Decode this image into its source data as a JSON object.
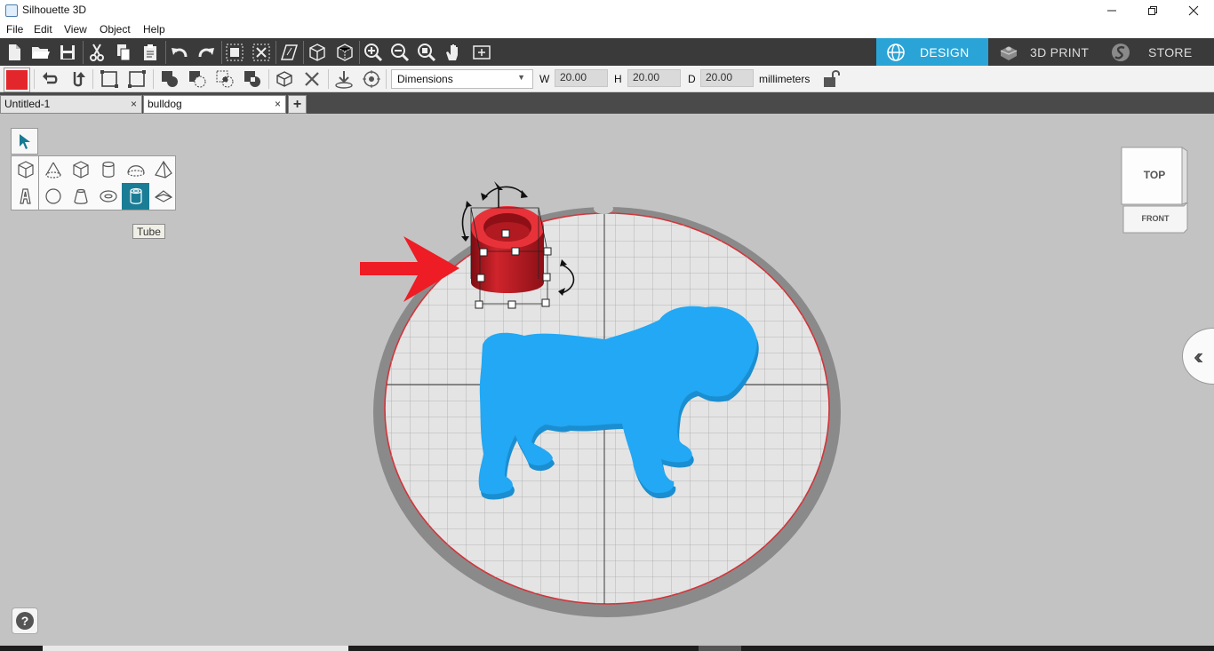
{
  "window": {
    "title": "Silhouette 3D",
    "minimize_icon": "minimize-icon",
    "restore_icon": "restore-icon",
    "close_icon": "close-icon"
  },
  "menu": {
    "items": [
      "File",
      "Edit",
      "View",
      "Object",
      "Help"
    ]
  },
  "main_toolbar": {
    "buttons": [
      "new-file-icon",
      "open-folder-icon",
      "save-icon",
      "cut-icon",
      "copy-icon",
      "paste-icon",
      "undo-icon",
      "redo-icon",
      "group-icon",
      "ungroup-icon",
      "perspective-icon",
      "box-view-icon",
      "wire-box-icon",
      "zoom-in-icon",
      "zoom-out-icon",
      "zoom-fit-icon",
      "pan-hand-icon",
      "fit-window-icon"
    ]
  },
  "mode_tabs": [
    {
      "label": "DESIGN",
      "icon": "globe-icon",
      "active": true
    },
    {
      "label": "3D PRINT",
      "icon": "printer-icon",
      "active": false
    },
    {
      "label": "STORE",
      "icon": "silhouette-s-icon",
      "active": false
    }
  ],
  "object_toolbar": {
    "color": "#e3262c",
    "dimension_mode": "Dimensions",
    "width_label": "W",
    "width_value": "20.00",
    "height_label": "H",
    "height_value": "20.00",
    "depth_label": "D",
    "depth_value": "20.00",
    "unit": "millimeters",
    "lock_icon": "unlock-icon"
  },
  "tabs": [
    {
      "label": "Untitled-1",
      "close": "×"
    },
    {
      "label": "bulldog",
      "close": "×"
    }
  ],
  "add_tab_label": "+",
  "shape_panel": {
    "tooltip": "Tube",
    "selected": "tube",
    "shapes": [
      "cube",
      "cone",
      "box",
      "cylinder",
      "half-sphere",
      "pyramid",
      "text",
      "sphere",
      "truncated-cone",
      "torus",
      "tube",
      "wedge"
    ]
  },
  "viewcube": {
    "top": "TOP",
    "front": "FRONT"
  },
  "scene": {
    "platform_color": "#e6e6e6",
    "object_color": "#c41a22",
    "model_color": "#22a8f4"
  },
  "help_label": "?"
}
